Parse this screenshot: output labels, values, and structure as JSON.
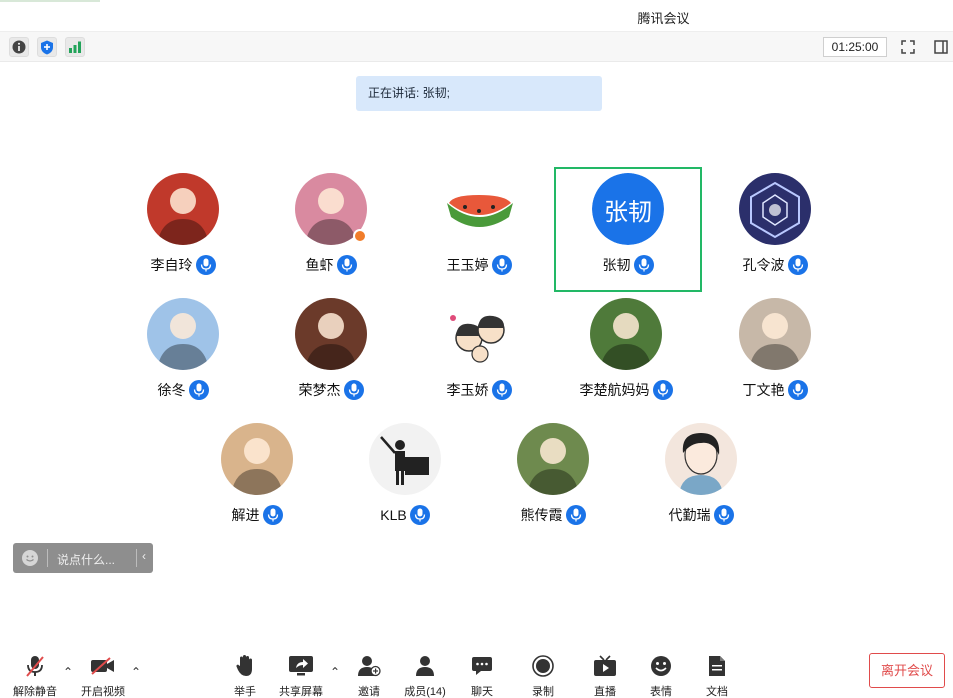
{
  "window": {
    "title": "腾讯会议"
  },
  "infobar": {
    "icons": [
      "info-icon",
      "shield-icon",
      "signal-icon"
    ],
    "timer": "01:25:00",
    "right_icons": [
      "fullscreen-icon",
      "sidebar-toggle-icon"
    ]
  },
  "speaking": {
    "text": "正在讲话: 张韧;"
  },
  "participants": [
    {
      "name": "李自玲",
      "avatar": "photo",
      "color": "#c0392b"
    },
    {
      "name": "鱼虾",
      "avatar": "photo",
      "color": "#d98aa0",
      "host": true
    },
    {
      "name": "王玉婷",
      "avatar": "watermelon",
      "color": "#e8583a"
    },
    {
      "name": "张韧",
      "avatar_text": "张韧",
      "active": true
    },
    {
      "name": "孔令波",
      "avatar": "cube",
      "color": "#2b2f6b"
    },
    {
      "name": "徐冬",
      "avatar": "photo",
      "color": "#9fc3e8"
    },
    {
      "name": "荣梦杰",
      "avatar": "photo",
      "color": "#6b3a2a"
    },
    {
      "name": "李玉娇",
      "avatar": "cartoon",
      "color": "#e9e9e9"
    },
    {
      "name": "李楚航妈妈",
      "avatar": "photo",
      "color": "#4f7a3a"
    },
    {
      "name": "丁文艳",
      "avatar": "photo",
      "color": "#c7b8a8"
    },
    {
      "name": "解进",
      "avatar": "photo",
      "color": "#d9b48c"
    },
    {
      "name": "KLB",
      "avatar": "teacher",
      "color": "#f2f2f2"
    },
    {
      "name": "熊传霞",
      "avatar": "photo",
      "color": "#6e8a4e"
    },
    {
      "name": "代勤瑞",
      "avatar": "anime",
      "color": "#f3e6dd"
    }
  ],
  "chat": {
    "placeholder": "说点什么..."
  },
  "toolbar": {
    "unmute": "解除静音",
    "video": "开启视频",
    "raise_hand": "举手",
    "share": "共享屏幕",
    "invite": "邀请",
    "members": "成员(14)",
    "chat": "聊天",
    "record": "录制",
    "live": "直播",
    "emoji": "表情",
    "docs": "文档",
    "leave": "离开会议"
  },
  "colors": {
    "accent": "#1a73e8",
    "active_border": "#22b866",
    "leave": "#e04b4b"
  }
}
